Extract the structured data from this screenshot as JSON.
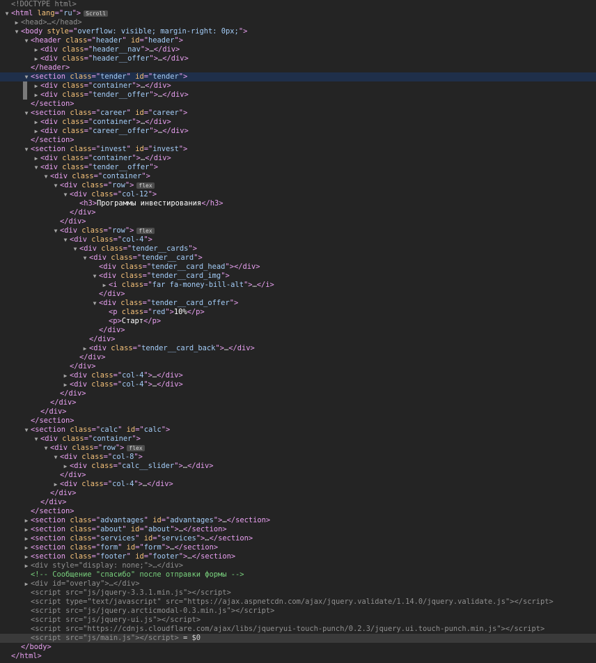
{
  "lines": [
    {
      "indent": 0,
      "tri": "none",
      "kind": "raw",
      "text": "<!DOCTYPE html>",
      "cls": "dim"
    },
    {
      "indent": 0,
      "tri": "open",
      "kind": "open",
      "tag": "html",
      "attrs": [
        [
          "lang",
          "ru"
        ]
      ],
      "badge": "Scroll"
    },
    {
      "indent": 1,
      "tri": "closed",
      "kind": "collapsed",
      "tag": "head",
      "attrs": [],
      "dim": true
    },
    {
      "indent": 1,
      "tri": "open",
      "kind": "open",
      "tag": "body",
      "attrs": [
        [
          "style",
          "overflow: visible; margin-right: 0px;"
        ]
      ]
    },
    {
      "indent": 2,
      "tri": "open",
      "kind": "open",
      "tag": "header",
      "attrs": [
        [
          "class",
          "header"
        ],
        [
          "id",
          "header"
        ]
      ]
    },
    {
      "indent": 3,
      "tri": "closed",
      "kind": "collapsed",
      "tag": "div",
      "attrs": [
        [
          "class",
          "header__nav"
        ]
      ]
    },
    {
      "indent": 3,
      "tri": "closed",
      "kind": "collapsed",
      "tag": "div",
      "attrs": [
        [
          "class",
          "header__offer"
        ]
      ]
    },
    {
      "indent": 2,
      "tri": "none",
      "kind": "close",
      "tag": "header"
    },
    {
      "indent": 2,
      "tri": "open",
      "kind": "open",
      "tag": "section",
      "attrs": [
        [
          "class",
          "tender"
        ],
        [
          "id",
          "tender"
        ]
      ],
      "sel": true
    },
    {
      "indent": 3,
      "tri": "closed",
      "kind": "collapsed",
      "tag": "div",
      "attrs": [
        [
          "class",
          "container"
        ]
      ],
      "mark": true
    },
    {
      "indent": 3,
      "tri": "closed",
      "kind": "collapsed",
      "tag": "div",
      "attrs": [
        [
          "class",
          "tender__offer"
        ]
      ],
      "mark": true
    },
    {
      "indent": 2,
      "tri": "none",
      "kind": "close",
      "tag": "section"
    },
    {
      "indent": 2,
      "tri": "open",
      "kind": "open",
      "tag": "section",
      "attrs": [
        [
          "class",
          "career"
        ],
        [
          "id",
          "career"
        ]
      ]
    },
    {
      "indent": 3,
      "tri": "closed",
      "kind": "collapsed",
      "tag": "div",
      "attrs": [
        [
          "class",
          "container"
        ]
      ]
    },
    {
      "indent": 3,
      "tri": "closed",
      "kind": "collapsed",
      "tag": "div",
      "attrs": [
        [
          "class",
          "career__offer"
        ]
      ]
    },
    {
      "indent": 2,
      "tri": "none",
      "kind": "close",
      "tag": "section"
    },
    {
      "indent": 2,
      "tri": "open",
      "kind": "open",
      "tag": "section",
      "attrs": [
        [
          "class",
          "invest"
        ],
        [
          "id",
          "invest"
        ]
      ]
    },
    {
      "indent": 3,
      "tri": "closed",
      "kind": "collapsed",
      "tag": "div",
      "attrs": [
        [
          "class",
          "container"
        ]
      ]
    },
    {
      "indent": 3,
      "tri": "open",
      "kind": "open",
      "tag": "div",
      "attrs": [
        [
          "class",
          "tender__offer"
        ]
      ]
    },
    {
      "indent": 4,
      "tri": "open",
      "kind": "open",
      "tag": "div",
      "attrs": [
        [
          "class",
          "container"
        ]
      ]
    },
    {
      "indent": 5,
      "tri": "open",
      "kind": "open",
      "tag": "div",
      "attrs": [
        [
          "class",
          "row"
        ]
      ],
      "badge": "flex"
    },
    {
      "indent": 6,
      "tri": "open",
      "kind": "open",
      "tag": "div",
      "attrs": [
        [
          "class",
          "col-12"
        ]
      ]
    },
    {
      "indent": 7,
      "tri": "none",
      "kind": "inline",
      "tag": "h3",
      "attrs": [],
      "text": "Программы инвестирования"
    },
    {
      "indent": 6,
      "tri": "none",
      "kind": "close",
      "tag": "div"
    },
    {
      "indent": 5,
      "tri": "none",
      "kind": "close",
      "tag": "div"
    },
    {
      "indent": 5,
      "tri": "open",
      "kind": "open",
      "tag": "div",
      "attrs": [
        [
          "class",
          "row"
        ]
      ],
      "badge": "flex"
    },
    {
      "indent": 6,
      "tri": "open",
      "kind": "open",
      "tag": "div",
      "attrs": [
        [
          "class",
          "col-4"
        ]
      ]
    },
    {
      "indent": 7,
      "tri": "open",
      "kind": "open",
      "tag": "div",
      "attrs": [
        [
          "class",
          "tender__cards"
        ]
      ]
    },
    {
      "indent": 8,
      "tri": "open",
      "kind": "open",
      "tag": "div",
      "attrs": [
        [
          "class",
          "tender__card"
        ]
      ]
    },
    {
      "indent": 9,
      "tri": "none",
      "kind": "empty",
      "tag": "div",
      "attrs": [
        [
          "class",
          "tender__card_head"
        ]
      ]
    },
    {
      "indent": 9,
      "tri": "open",
      "kind": "open",
      "tag": "div",
      "attrs": [
        [
          "class",
          "tender__card_img"
        ]
      ]
    },
    {
      "indent": 10,
      "tri": "closed",
      "kind": "collapsed",
      "tag": "i",
      "attrs": [
        [
          "class",
          "far fa-money-bill-alt"
        ]
      ]
    },
    {
      "indent": 9,
      "tri": "none",
      "kind": "close",
      "tag": "div"
    },
    {
      "indent": 9,
      "tri": "open",
      "kind": "open",
      "tag": "div",
      "attrs": [
        [
          "class",
          "tender__card_offer"
        ]
      ]
    },
    {
      "indent": 10,
      "tri": "none",
      "kind": "inline",
      "tag": "p",
      "attrs": [
        [
          "class",
          "red"
        ]
      ],
      "text": "10%"
    },
    {
      "indent": 10,
      "tri": "none",
      "kind": "inline",
      "tag": "p",
      "attrs": [],
      "text": "Старт"
    },
    {
      "indent": 9,
      "tri": "none",
      "kind": "close",
      "tag": "div"
    },
    {
      "indent": 8,
      "tri": "none",
      "kind": "close",
      "tag": "div"
    },
    {
      "indent": 8,
      "tri": "closed",
      "kind": "collapsed",
      "tag": "div",
      "attrs": [
        [
          "class",
          "tender__card_back"
        ]
      ]
    },
    {
      "indent": 7,
      "tri": "none",
      "kind": "close",
      "tag": "div"
    },
    {
      "indent": 6,
      "tri": "none",
      "kind": "close",
      "tag": "div"
    },
    {
      "indent": 6,
      "tri": "closed",
      "kind": "collapsed",
      "tag": "div",
      "attrs": [
        [
          "class",
          "col-4"
        ]
      ]
    },
    {
      "indent": 6,
      "tri": "closed",
      "kind": "collapsed",
      "tag": "div",
      "attrs": [
        [
          "class",
          "col-4"
        ]
      ]
    },
    {
      "indent": 5,
      "tri": "none",
      "kind": "close",
      "tag": "div"
    },
    {
      "indent": 4,
      "tri": "none",
      "kind": "close",
      "tag": "div"
    },
    {
      "indent": 3,
      "tri": "none",
      "kind": "close",
      "tag": "div"
    },
    {
      "indent": 2,
      "tri": "none",
      "kind": "close",
      "tag": "section"
    },
    {
      "indent": 2,
      "tri": "open",
      "kind": "open",
      "tag": "section",
      "attrs": [
        [
          "class",
          "calc"
        ],
        [
          "id",
          "calc"
        ]
      ]
    },
    {
      "indent": 3,
      "tri": "open",
      "kind": "open",
      "tag": "div",
      "attrs": [
        [
          "class",
          "container"
        ]
      ]
    },
    {
      "indent": 4,
      "tri": "open",
      "kind": "open",
      "tag": "div",
      "attrs": [
        [
          "class",
          "row"
        ]
      ],
      "badge": "flex"
    },
    {
      "indent": 5,
      "tri": "open",
      "kind": "open",
      "tag": "div",
      "attrs": [
        [
          "class",
          "col-8"
        ]
      ]
    },
    {
      "indent": 6,
      "tri": "closed",
      "kind": "collapsed",
      "tag": "div",
      "attrs": [
        [
          "class",
          "calc__slider"
        ]
      ]
    },
    {
      "indent": 5,
      "tri": "none",
      "kind": "close",
      "tag": "div"
    },
    {
      "indent": 5,
      "tri": "closed",
      "kind": "collapsed",
      "tag": "div",
      "attrs": [
        [
          "class",
          "col-4"
        ]
      ]
    },
    {
      "indent": 4,
      "tri": "none",
      "kind": "close",
      "tag": "div"
    },
    {
      "indent": 3,
      "tri": "none",
      "kind": "close",
      "tag": "div"
    },
    {
      "indent": 2,
      "tri": "none",
      "kind": "close",
      "tag": "section"
    },
    {
      "indent": 2,
      "tri": "closed",
      "kind": "collapsed",
      "tag": "section",
      "attrs": [
        [
          "class",
          "advantages"
        ],
        [
          "id",
          "advantages"
        ]
      ]
    },
    {
      "indent": 2,
      "tri": "closed",
      "kind": "collapsed",
      "tag": "section",
      "attrs": [
        [
          "class",
          "about"
        ],
        [
          "id",
          "about"
        ]
      ]
    },
    {
      "indent": 2,
      "tri": "closed",
      "kind": "collapsed",
      "tag": "section",
      "attrs": [
        [
          "class",
          "services"
        ],
        [
          "id",
          "services"
        ]
      ]
    },
    {
      "indent": 2,
      "tri": "closed",
      "kind": "collapsed",
      "tag": "section",
      "attrs": [
        [
          "class",
          "form"
        ],
        [
          "id",
          "form"
        ]
      ]
    },
    {
      "indent": 2,
      "tri": "closed",
      "kind": "collapsed",
      "tag": "section",
      "attrs": [
        [
          "class",
          "footer"
        ],
        [
          "id",
          "footer"
        ]
      ]
    },
    {
      "indent": 2,
      "tri": "closed",
      "kind": "collapsed",
      "tag": "div",
      "attrs": [
        [
          "style",
          "display: none;"
        ]
      ],
      "dim": true
    },
    {
      "indent": 2,
      "tri": "none",
      "kind": "comment",
      "text": "<!-- Сообщение \"спасибо\" после отправки формы -->"
    },
    {
      "indent": 2,
      "tri": "closed",
      "kind": "collapsed",
      "tag": "div",
      "attrs": [
        [
          "id",
          "overlay"
        ]
      ],
      "dim": true
    },
    {
      "indent": 2,
      "tri": "none",
      "kind": "script",
      "tag": "script",
      "attrs": [
        [
          "src",
          "js/jquery-3.3.1.min.js"
        ]
      ],
      "dim": true
    },
    {
      "indent": 2,
      "tri": "none",
      "kind": "script",
      "tag": "script",
      "attrs": [
        [
          "type",
          "text/javascript"
        ],
        [
          "src",
          "https://ajax.aspnetcdn.com/ajax/jquery.validate/1.14.0/jquery.validate.js"
        ]
      ],
      "dim": true
    },
    {
      "indent": 2,
      "tri": "none",
      "kind": "script",
      "tag": "script",
      "attrs": [
        [
          "src",
          "js/jquery.arcticmodal-0.3.min.js"
        ]
      ],
      "dim": true
    },
    {
      "indent": 2,
      "tri": "none",
      "kind": "script",
      "tag": "script",
      "attrs": [
        [
          "src",
          "js/jquery-ui.js"
        ]
      ],
      "dim": true
    },
    {
      "indent": 2,
      "tri": "none",
      "kind": "script",
      "tag": "script",
      "attrs": [
        [
          "src",
          "https://cdnjs.cloudflare.com/ajax/libs/jqueryui-touch-punch/0.2.3/jquery.ui.touch-punch.min.js"
        ]
      ],
      "dim": true
    },
    {
      "indent": 2,
      "tri": "none",
      "kind": "script",
      "tag": "script",
      "attrs": [
        [
          "src",
          "js/main.js"
        ]
      ],
      "dim": true,
      "cur": true,
      "suffix": " = $0"
    },
    {
      "indent": 1,
      "tri": "none",
      "kind": "close",
      "tag": "body"
    },
    {
      "indent": 0,
      "tri": "none",
      "kind": "close",
      "tag": "html"
    }
  ],
  "symbols": {
    "tri_open": "▼",
    "tri_closed": "▶",
    "ellipsis": "…"
  },
  "colors": {
    "background": "#242424",
    "tag": "#e8a0f0",
    "attr_name": "#f5c27a",
    "attr_value": "#a4cdf8",
    "text": "#ffffff",
    "comment": "#79d17d",
    "selected_row": "#1f2f4a"
  }
}
